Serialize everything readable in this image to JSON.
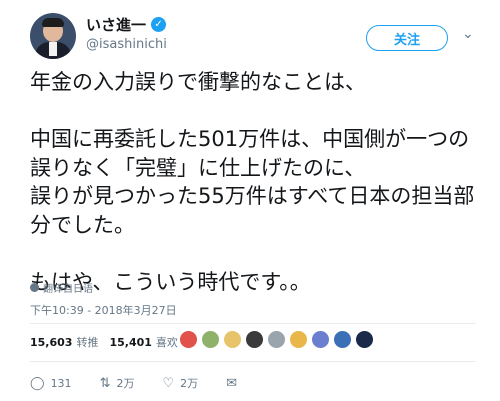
{
  "author": {
    "name": "いさ進一",
    "handle": "@isashinichi",
    "verified_icon": "✓"
  },
  "follow_label": "关注",
  "caret_icon": "⌄",
  "tweet_text": "年金の入力誤りで衝撃的なことは、\n\n中国に再委託した501万件は、中国側が一つの誤りなく「完璧」に仕上げたのに、\n誤りが見つかった55万件はすべて日本の担当部分でした。\n\nもはや、こういう時代です。。",
  "translate_label": "翻译自日语",
  "timestamp": "下午10:39 - 2018年3月27日",
  "stats": {
    "retweets_count": "15,603",
    "retweets_label": "转推",
    "likes_count": "15,401",
    "likes_label": "喜欢"
  },
  "liker_colors": [
    "#e0524a",
    "#8fb26a",
    "#e7c36a",
    "#3a3a3a",
    "#9aa4ad",
    "#e9b64a",
    "#6a7fd0",
    "#3b6fb6",
    "#1b2a4a"
  ],
  "actions": {
    "reply_count": "131",
    "retweet_count": "2万",
    "like_count": "2万",
    "reply_icon": "◯",
    "retweet_icon": "⇅",
    "like_icon": "♡",
    "dm_icon": "✉"
  }
}
